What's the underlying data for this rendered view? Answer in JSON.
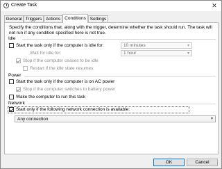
{
  "window": {
    "title": "Create Task",
    "close_glyph": "✕"
  },
  "tabs": [
    {
      "label": "General",
      "active": false
    },
    {
      "label": "Triggers",
      "active": false
    },
    {
      "label": "Actions",
      "active": false
    },
    {
      "label": "Conditions",
      "active": true
    },
    {
      "label": "Settings",
      "active": false
    }
  ],
  "conditions": {
    "description": "Specify the conditions that, along with the trigger, determine whether the task should run.  The task will not run  if any condition specified here is not true.",
    "idle": {
      "section_label": "Idle",
      "start_if_idle": {
        "label": "Start the task only if the computer is idle for:",
        "checked": false,
        "value": "10 minutes"
      },
      "wait_for_idle": {
        "label": "Wait for idle for:",
        "value": "1 hour"
      },
      "stop_if_not_idle": {
        "label": "Stop if the computer ceases to be idle",
        "checked": true
      },
      "restart_if_idle": {
        "label": "Restart if the idle state resumes",
        "checked": false
      }
    },
    "power": {
      "section_label": "Power",
      "ac_power": {
        "label": "Start the task only if the computer is on AC power",
        "checked": false
      },
      "stop_on_battery": {
        "label": "Stop if the computer switches to battery power",
        "checked": true
      },
      "wake": {
        "label": "Wake the computer to run this task",
        "checked": false
      }
    },
    "network": {
      "section_label": "Network",
      "network_only": {
        "label": "Start only if the following network connection is available:",
        "checked": true
      },
      "connection": {
        "value": "Any connection"
      }
    }
  },
  "buttons": {
    "ok": "OK",
    "cancel": "Cancel"
  },
  "icons": {
    "dropdown": "▾",
    "window_icon": "clock-icon"
  }
}
